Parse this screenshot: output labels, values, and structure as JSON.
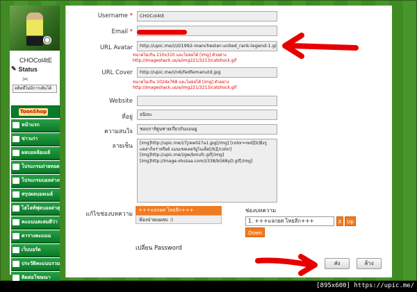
{
  "sidebar": {
    "username": "CHOCol4tE",
    "status_label": "Status",
    "edit_button": "อดิตที่ไม่มีการเดิมได้",
    "menu_header": "ToonShop",
    "items": [
      {
        "label": "หน้าแรก"
      },
      {
        "label": "ข่าวเก่า"
      },
      {
        "label": "ผลบอลล้อเมล์"
      },
      {
        "label": "โปรแกรมถ่ายทอดสด"
      },
      {
        "label": "โปรแกรมบอลล่างหน้า"
      },
      {
        "label": "สรุปผลบอลเมล์"
      },
      {
        "label": "ไฮไลท์ฟุตบอลล่าสุด"
      },
      {
        "label": "คะแนนสะสมดีว่า"
      },
      {
        "label": "ตารางคะแนน"
      },
      {
        "label": "เว็บบอร์ด"
      },
      {
        "label": "ประวัติคะแนนรวม"
      },
      {
        "label": "ติดต่อโฆษณา"
      }
    ]
  },
  "form": {
    "username": {
      "label": "Username",
      "value": "CHOCol4tE"
    },
    "email": {
      "label": "Email"
    },
    "avatar": {
      "label": "URL Avatar",
      "value": "http://upic.me/i/zl/1992-manchester-united_rank-legend-1.gif",
      "note1": "ขนาดไม่เกิน 210x310 และไม่ย่อได้ [img] ตัวอย่าง",
      "note2": "http://imageshack.us/a/img221/3213/catshock.gif"
    },
    "cover": {
      "label": "URL Cover",
      "value": "http://upic.me/i/n6/fedfemanutd.jpg",
      "note1": "ขนาดไม่เกิน 1024x768 และไม่ย่อได้ [img] ตัวอย่าง",
      "note2": "http://imageshack.us/a/img221/3213/catshock.gif"
    },
    "website": {
      "label": "Website",
      "value": ""
    },
    "location": {
      "label": "ที่อยู่",
      "value": "อนิเมะ"
    },
    "interest": {
      "label": "ความสนใจ",
      "value": "ชอบการ์ตูนชายเกี่ยวกับแมนยู"
    },
    "signature": {
      "label": "ลายเซ็น",
      "lines": [
        "[img]http://upic.me/i/7j/ew027a1.jpg[/img] [color=red][b]ยิ่งรู ",
        "แคล่าก็หร่าหรือย์ แมนเชสเตอร์ยูไนเต็ด[/b][/color]",
        "[img]http://upic.me/i/gw/bmufc.gif[/img]",
        "[img]http://image.ohozaa.com/i/338/bG68yD.gif[/img]"
      ]
    },
    "channel": {
      "label": "แก้ไขช่องบทความ",
      "options": [
        "+++แจกยศ ไทยลีก+++",
        "ห้องจ่ายแผลบ :)"
      ],
      "selected_label": "ช่องบทความ",
      "selected_value": "1. +++แจกยศ ไทยลีก+++",
      "x_button": "X",
      "up_button": "Up",
      "down_button": "Down"
    },
    "password_link": "เปลี่ยน Password",
    "submit": "ส่ง",
    "reset": "ล้าง"
  },
  "footer": {
    "text": "[895x600] https://upic.me/"
  },
  "colors": {
    "menu_green": "#0b7a2a",
    "accent_orange": "#f07b22",
    "required_red": "#dd0000"
  }
}
